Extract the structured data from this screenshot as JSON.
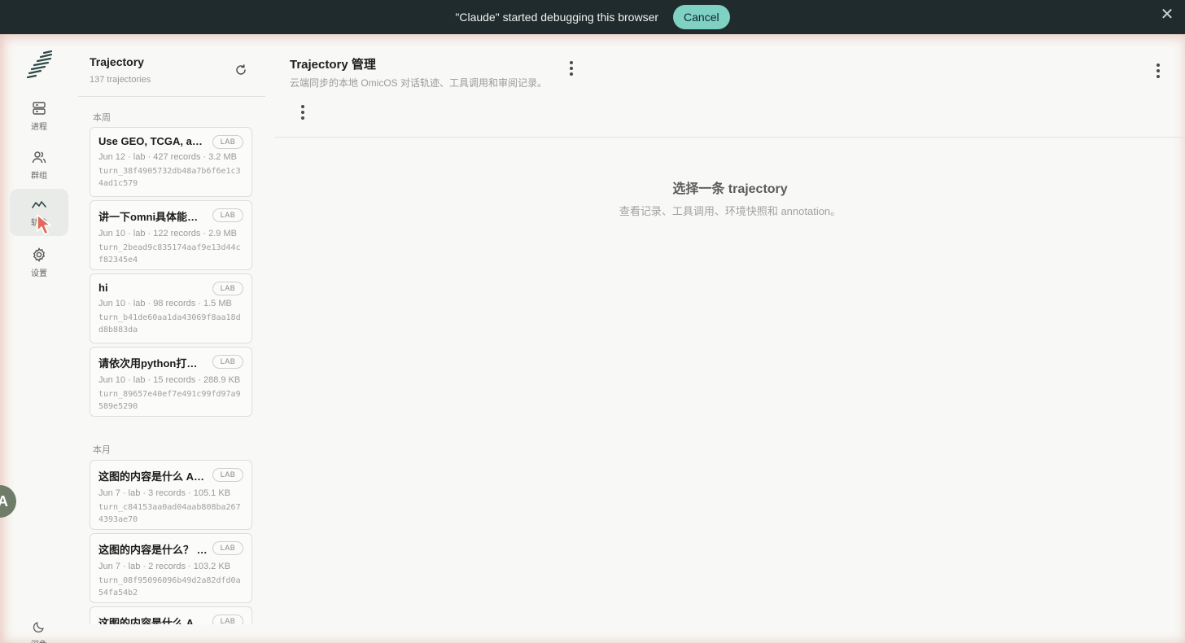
{
  "debug_banner": {
    "message": "\"Claude\" started debugging this browser",
    "cancel_label": "Cancel",
    "close_glyph": "✕"
  },
  "rail": {
    "items": [
      {
        "label": "进程",
        "icon": "server-stack-icon"
      },
      {
        "label": "群组",
        "icon": "users-icon"
      },
      {
        "label": "轨迹",
        "icon": "trend-line-icon"
      },
      {
        "label": "设置",
        "icon": "gear-icon"
      }
    ],
    "theme": {
      "label": "深色",
      "icon": "moon-icon"
    },
    "avatar_initial": "A"
  },
  "list": {
    "title": "Trajectory",
    "count": "137 trajectories",
    "groups": [
      {
        "label": "本周",
        "cards": [
          {
            "title": "Use GEO, TCGA, and other public datasets",
            "badge": "LAB",
            "meta": "Jun 12 · lab · 427 records · 3.2 MB",
            "id": "turn_38f4905732db48a7b6f6e1c34ad1c579"
          },
          {
            "title": "讲一下omni具体能干什么",
            "badge": "LAB",
            "meta": "Jun 10 · lab · 122 records · 2.9 MB",
            "id": "turn_2bead9c835174aaf9e13d44cf82345e4"
          },
          {
            "title": "hi",
            "badge": "LAB",
            "meta": "Jun 10 · lab · 98 records · 1.5 MB",
            "id": "turn_b41de60aa1da43069f8aa18dd8b883da"
          },
          {
            "title": "请依次用python打印数字",
            "badge": "LAB",
            "meta": "Jun 10 · lab · 15 records · 288.9 KB",
            "id": "turn_89657e40ef7e491c99fd97a9589e5290"
          }
        ]
      },
      {
        "label": "本月",
        "cards": [
          {
            "title": "这图的内容是什么 Attachment",
            "badge": "LAB",
            "meta": "Jun 7 · lab · 3 records · 105.1 KB",
            "id": "turn_c84153aa0ad04aab808ba2674393ae70"
          },
          {
            "title": "这图的内容是什么？ Attachment",
            "badge": "LAB",
            "meta": "Jun 7 · lab · 2 records · 103.2 KB",
            "id": "turn_08f95096096b49d2a82dfd0a54fa54b2"
          },
          {
            "title": "这图的内容是什么 Attachment",
            "badge": "LAB",
            "meta": "",
            "id": ""
          }
        ]
      }
    ]
  },
  "main": {
    "title": "Trajectory 管理",
    "subtitle": "云端同步的本地 OmicOS 对话轨迹、工具调用和审阅记录。",
    "empty_title": "选择一条 trajectory",
    "empty_desc": "查看记录、工具调用、环境快照和 annotation。"
  }
}
